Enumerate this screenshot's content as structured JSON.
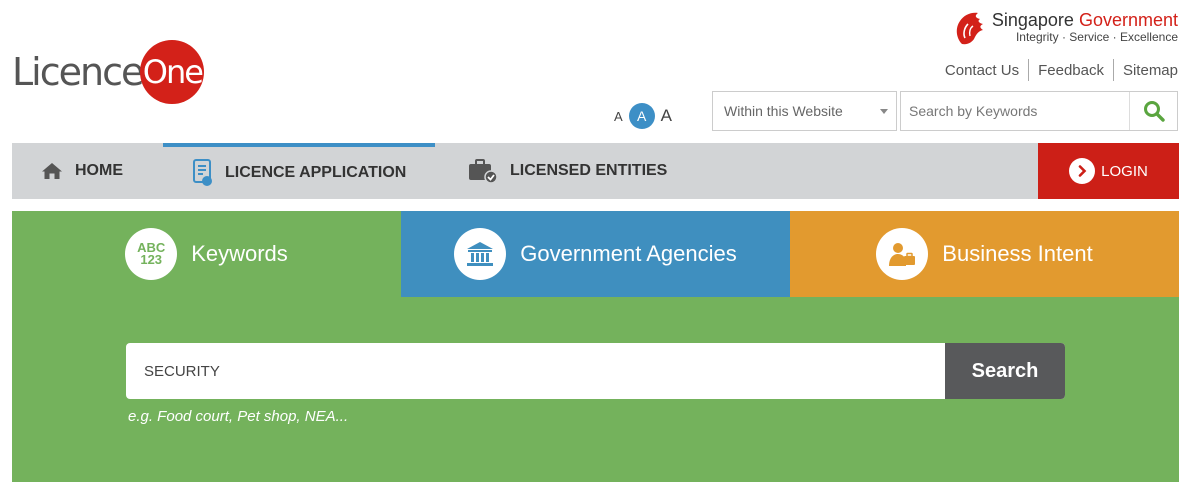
{
  "brand": {
    "logo_part1": "Licence",
    "logo_part2": "One"
  },
  "gov_banner": {
    "title_prefix": "Singapore",
    "title_suffix": "Government",
    "motto": "Integrity · Service · Excellence"
  },
  "top_links": [
    "Contact Us",
    "Feedback",
    "Sitemap"
  ],
  "font_size_controls": {
    "small": "A",
    "medium": "A",
    "large": "A",
    "active": "medium"
  },
  "site_search": {
    "scope_selected": "Within this Website",
    "placeholder": "Search by Keywords",
    "icon": "search-icon"
  },
  "nav": {
    "home": "HOME",
    "licence_application": "LICENCE APPLICATION",
    "licensed_entities": "LICENSED ENTITIES",
    "login": "LOGIN",
    "active": "licence_application"
  },
  "search_tabs": {
    "keywords": {
      "label": "Keywords",
      "icon_text_top": "ABC",
      "icon_text_bottom": "123"
    },
    "agencies": {
      "label": "Government Agencies",
      "icon": "building-icon"
    },
    "intent": {
      "label": "Business Intent",
      "icon": "business-person-icon"
    },
    "active": "keywords"
  },
  "keyword_search": {
    "value": "SECURITY",
    "button_label": "Search",
    "hint": "e.g. Food court, Pet shop, NEA..."
  },
  "colors": {
    "brand_red": "#d32119",
    "accent_blue": "#3d8fc6",
    "panel_green": "#74b25c",
    "agencies_blue": "#3f8fbf",
    "intent_orange": "#e29a2f",
    "nav_gray": "#d2d4d6"
  }
}
